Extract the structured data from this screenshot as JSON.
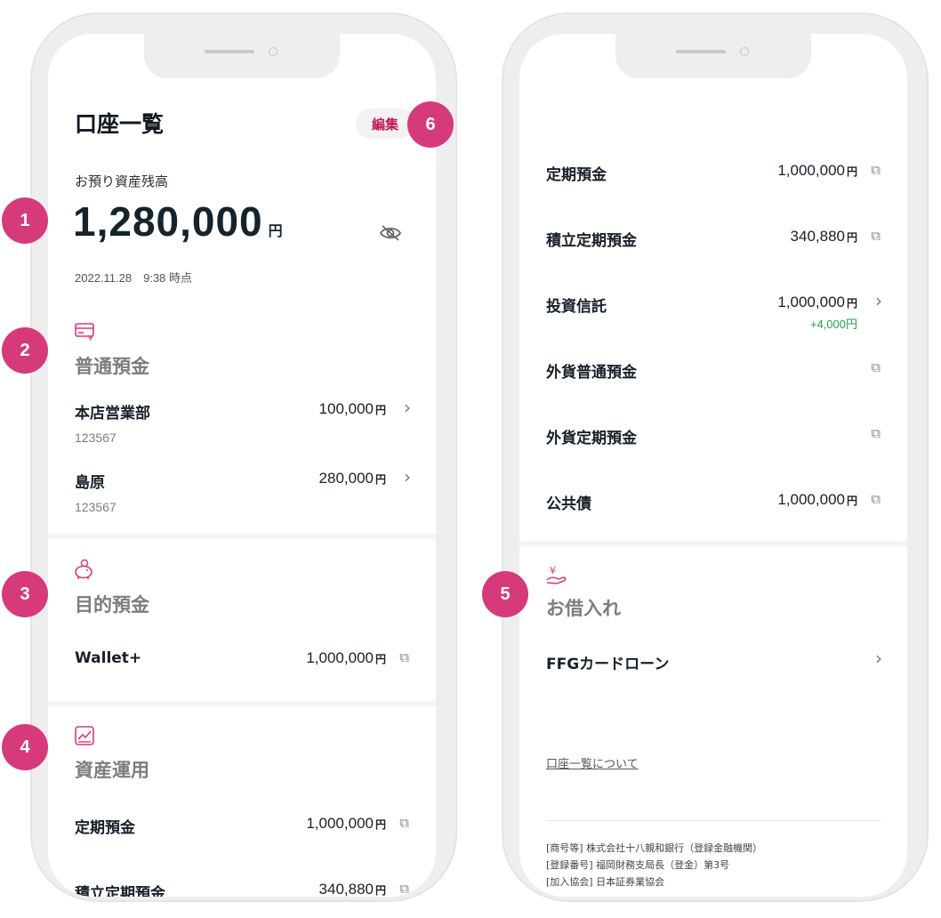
{
  "left_screen": {
    "title": "口座一覧",
    "edit_label": "編集",
    "balance_label": "お預り資産残高",
    "balance": "1,280,000",
    "balance_unit": "円",
    "timestamp": "2022.11.28　9:38 時点",
    "savings": {
      "title": "普通預金",
      "icon": "savings-card-icon",
      "rows": [
        {
          "name": "本店営業部",
          "number": "123567",
          "amount": "100,000",
          "unit": "円"
        },
        {
          "name": "島原",
          "number": "123567",
          "amount": "280,000",
          "unit": "円"
        }
      ]
    },
    "purpose": {
      "title": "目的預金",
      "icon": "piggy-bank-icon",
      "rows": [
        {
          "name": "Wallet+",
          "amount": "1,000,000",
          "unit": "円"
        }
      ]
    },
    "assets": {
      "title": "資産運用",
      "icon": "chart-icon",
      "rows": [
        {
          "name": "定期預金",
          "amount": "1,000,000",
          "unit": "円"
        },
        {
          "name": "積立定期預金",
          "amount": "340,880",
          "unit": "円"
        }
      ]
    }
  },
  "right_screen": {
    "rows": [
      {
        "name": "定期預金",
        "amount": "1,000,000",
        "unit": "円"
      },
      {
        "name": "積立定期預金",
        "amount": "340,880",
        "unit": "円"
      },
      {
        "name": "投資信託",
        "amount": "1,000,000",
        "unit": "円",
        "gain": "+4,000円"
      },
      {
        "name": "外貨普通預金"
      },
      {
        "name": "外貨定期預金"
      },
      {
        "name": "公共債",
        "amount": "1,000,000",
        "unit": "円"
      }
    ],
    "loans": {
      "title": "お借入れ",
      "icon": "loan-hand-icon",
      "rows": [
        {
          "name": "FFGカードローン"
        }
      ]
    },
    "about_link": "口座一覧について",
    "footer": [
      "[商号等] 株式会社十八親和銀行（登録金融機関）",
      "[登録番号] 福岡財務支局長（登金）第3号",
      "[加入協会] 日本証券業協会"
    ]
  },
  "markers": [
    "1",
    "2",
    "3",
    "4",
    "5",
    "6"
  ],
  "colors": {
    "accent": "#d63a7b",
    "edit_text": "#c2185b",
    "gain": "#23a046",
    "divider": "#f1f4f7"
  }
}
